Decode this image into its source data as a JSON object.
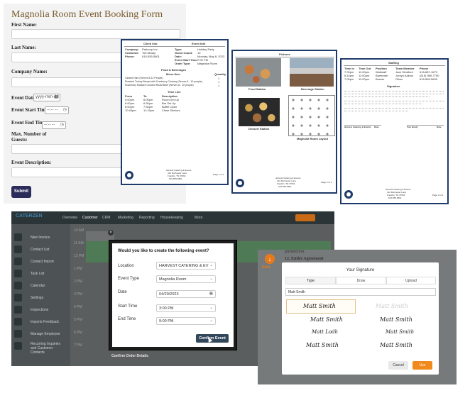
{
  "form": {
    "title": "Magnolia Room Event Booking Form",
    "first": "First Name:",
    "last": "Last Name:",
    "company": "Company Name:",
    "date": "Event Date:",
    "date_ph": "yyyy-mm-dd",
    "start": "Event Start Time:",
    "end": "Event End Time:",
    "time_ph": "--:-- --",
    "guests1": "Max. Number of",
    "guests2": "Guests:",
    "desc": "Event Description:",
    "submit": "Submit"
  },
  "doc1": {
    "h1": "Client Info",
    "h2": "Event Info",
    "company_l": "Company:",
    "company_v": "Partcorp Inc.",
    "customer_l": "Customer:",
    "customer_v": "Tom Brady",
    "phone_l": "Phone:",
    "phone_v": "615-555-5801",
    "type_l": "Type:",
    "type_v": "Holiday Party",
    "guest_l": "Guest Count:",
    "guest_v": "10",
    "date_l": "Date:",
    "date_v": "Monday, May 8, 2023",
    "st_l": "Event Start Time:",
    "st_v": "7:00 PM",
    "ord_l": "Order Type:",
    "ord_v": "Magnolia Room",
    "fb": "Food & Beverages",
    "mi": "Menu Item",
    "qty": "Quantity",
    "items": [
      {
        "n": "Glazed Ham (Serves 8-12 People)",
        "q": "1"
      },
      {
        "n": "Roasted Turkey Breast with Cranberry Chutney (Serves 8 - 10 people)",
        "q": "1"
      },
      {
        "n": "Rosemary Mustard Crusted Roast Beef (Serves 8 - 10 people)",
        "q": "1"
      }
    ],
    "tl": "Time Line",
    "from": "From",
    "to": "To",
    "descl": "Description",
    "rows": [
      {
        "f": "5:00pm",
        "t": "6:00pm",
        "d": "Room Set Up"
      },
      {
        "f": "6:00pm",
        "t": "6:30pm",
        "d": "Bar Set Up"
      },
      {
        "f": "6:00pm",
        "t": "7:30pm",
        "d": "Buffet Open"
      },
      {
        "f": "10:45pm",
        "t": "11:15pm",
        "d": "Close Shelves"
      }
    ],
    "foot1": "Harvest Catering & Events",
    "foot2": "412 Rochester Lane",
    "foot3": "Franklin, TN 37064",
    "foot4": "615-555-5801",
    "page": "Page 1 of 3"
  },
  "doc2": {
    "title": "Pictures",
    "p1": "Food Station",
    "p2": "Beverage Station",
    "p3": "Dessert Station",
    "p4": "Magnolia Room Layout",
    "page": "Page 2 of 3"
  },
  "doc3": {
    "title": "Staffing",
    "h": [
      "Time In",
      "Time Out",
      "Position",
      "Team Member",
      "Phone"
    ],
    "rows": [
      [
        "7:00pm",
        "11:00pm",
        "Waitstaff",
        "Jack Stratford",
        "615-887-1679"
      ],
      [
        "6:10pm",
        "11:00pm",
        "Bartender",
        "Jordyn Adkins",
        "(615) 989-7790"
      ],
      [
        "7:00pm",
        "11:00pm",
        "Busser",
        "Oliver",
        "615-555-5699"
      ]
    ],
    "sig": "Signature",
    "l1": "Harvest Catering & Events",
    "l2": "Date",
    "l3": "Tom Brady",
    "l4": "Date",
    "page": "Page 3 of 3"
  },
  "cz": {
    "logo": "CATERZEN",
    "nav": [
      "Overview",
      "Customer",
      "CRM",
      "Marketing",
      "Reporting",
      "Housekeeping",
      "More"
    ],
    "side": [
      "New Invoice",
      "Contact List",
      "Contact Import",
      "Task List",
      "Calendar",
      "Settings",
      "Inspections",
      "Imports Feedback",
      "Manage Employee",
      "Recurring Inquiries and Customer Contacts"
    ],
    "times": [
      "10 AM",
      "11 AM",
      "12 PM",
      "1 PM",
      "2 PM",
      "3 PM",
      "4 PM",
      "5 PM",
      "6 PM",
      "7 PM"
    ],
    "confirm_details": "Confirm Order Details"
  },
  "modal": {
    "question": "Would you like to create the following event?",
    "location_l": "Location",
    "location_v": "HARVEST CATERING & EV",
    "type_l": "Event Type",
    "type_v": "Magnolia Room",
    "date_l": "Date",
    "date_v": "04/29/2023",
    "start_l": "Start Time",
    "start_v": "3:00 PM",
    "end_l": "End Time",
    "end_v": "9:00 PM",
    "confirm": "Confirm Event"
  },
  "sig": {
    "title": "Your Signature",
    "tabs": [
      "Type",
      "Draw",
      "Upload"
    ],
    "input": "Matt Smith",
    "samples": [
      "Matt Smith",
      "Matt Smith",
      "Matt Smith",
      "Matt Smith",
      "Matt Lodh",
      "Matt Smith",
      "Matt Smith",
      "Matt Smith"
    ],
    "cancel": "Cancel",
    "ok": "Use",
    "bg1": "jurisdiction.",
    "bg2": "12. Entire Agreement",
    "start": "Start"
  },
  "colors": {
    "navy": "#1f3b6a",
    "accent": "#e8791a",
    "submit": "#2c2c5a"
  }
}
